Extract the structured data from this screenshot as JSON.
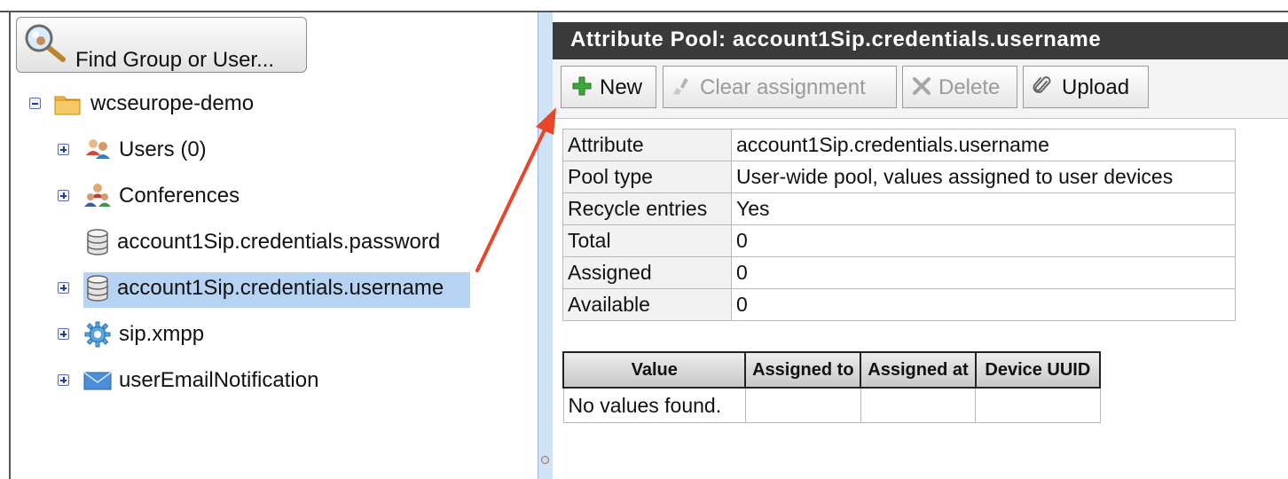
{
  "tree_panel": {
    "find_button_label": "Find Group or User...",
    "items": [
      {
        "label": "wcseurope-demo",
        "icon": "folder-icon",
        "toggle": "minus"
      },
      {
        "label": "Users (0)",
        "icon": "users-icon",
        "toggle": "plus"
      },
      {
        "label": "Conferences",
        "icon": "conference-icon",
        "toggle": "plus"
      },
      {
        "label": "account1Sip.credentials.password",
        "icon": "database-icon",
        "toggle": "none"
      },
      {
        "label": "account1Sip.credentials.username",
        "icon": "database-icon",
        "toggle": "plus",
        "selected": true
      },
      {
        "label": "sip.xmpp",
        "icon": "gear-icon",
        "toggle": "plus"
      },
      {
        "label": "userEmailNotification",
        "icon": "envelope-icon",
        "toggle": "plus"
      }
    ]
  },
  "panel": {
    "title": "Attribute Pool: account1Sip.credentials.username",
    "toolbar": {
      "new_label": "New",
      "clear_label": "Clear assignment",
      "delete_label": "Delete",
      "upload_label": "Upload"
    },
    "attributes": [
      {
        "key": "Attribute",
        "value": "account1Sip.credentials.username"
      },
      {
        "key": "Pool type",
        "value": "User-wide pool, values assigned to user devices"
      },
      {
        "key": "Recycle entries",
        "value": "Yes"
      },
      {
        "key": "Total",
        "value": "0"
      },
      {
        "key": "Assigned",
        "value": "0"
      },
      {
        "key": "Available",
        "value": "0"
      }
    ],
    "values_table": {
      "headers": [
        "Value",
        "Assigned to",
        "Assigned at",
        "Device UUID"
      ],
      "empty_message": "No values found."
    }
  },
  "colors": {
    "header_bg": "#3a3a3a",
    "selection": "#b7d3f3",
    "splitter": "#cfe2f6",
    "arrow": "#e8452b"
  }
}
